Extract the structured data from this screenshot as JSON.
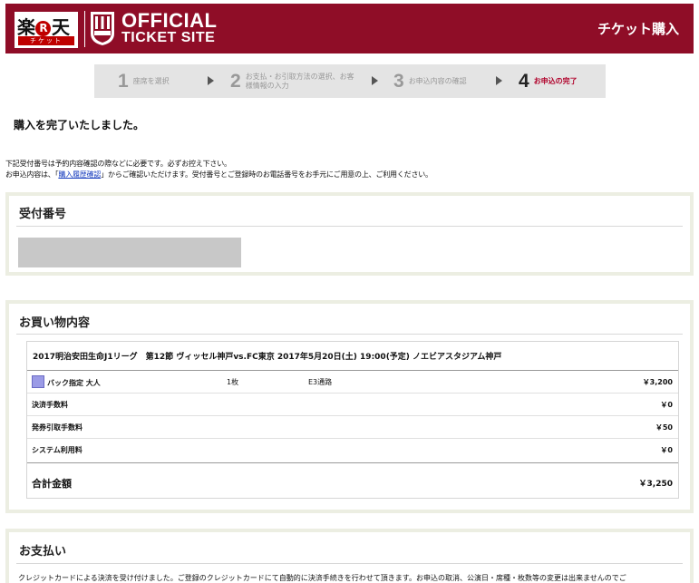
{
  "header": {
    "rakuten_logo": "楽天",
    "rakuten_sub": "チケット",
    "official_line1": "OFFICIAL",
    "official_line2": "TICKET SITE",
    "right_title": "チケット購入",
    "colors": {
      "header_bg": "#8f0d27",
      "rakuten_red": "#bf0000"
    }
  },
  "steps": [
    {
      "num": "1",
      "label": "座席を選択",
      "active": false
    },
    {
      "num": "2",
      "label": "お支払・お引取方法の選択、お客様情報の入力",
      "active": false
    },
    {
      "num": "3",
      "label": "お申込内容の確認",
      "active": false
    },
    {
      "num": "4",
      "label": "お申込の完了",
      "active": true
    }
  ],
  "complete_message": "購入を完了いたしました。",
  "notes": {
    "line1": "下記受付番号は予約内容確認の際などに必要です。必ずお控え下さい。",
    "line2_prefix": "お申込内容は、「",
    "line2_link": "購入履歴確認",
    "line2_suffix": "」からご確認いただけます。受付番号とご登録時のお電話番号をお手元にご用意の上、ご利用ください。"
  },
  "receipt": {
    "title": "受付番号"
  },
  "order": {
    "title": "お買い物内容",
    "event": "2017明治安田生命J1リーグ　第12節 ヴィッセル神戸vs.FC東京 2017年5月20日(土) 19:00(予定) ノエビアスタジアム神戸",
    "ticket": {
      "name": "バック指定 大人",
      "qty": "1枚",
      "seat": "E3通路",
      "price": "￥3,200"
    },
    "fees": [
      {
        "label": "決済手数料",
        "value": "￥0"
      },
      {
        "label": "発券引取手数料",
        "value": "￥50"
      },
      {
        "label": "システム利用料",
        "value": "￥0"
      }
    ],
    "total_label": "合計金額",
    "total_value": "￥3,250"
  },
  "payment": {
    "title": "お支払い",
    "text": "クレジットカードによる決済を受け付けました。ご登録のクレジットカードにて自動的に決済手続きを行わせて頂きます。お申込の取消、公演日・席種・枚数等の変更は出来ませんのでご"
  }
}
